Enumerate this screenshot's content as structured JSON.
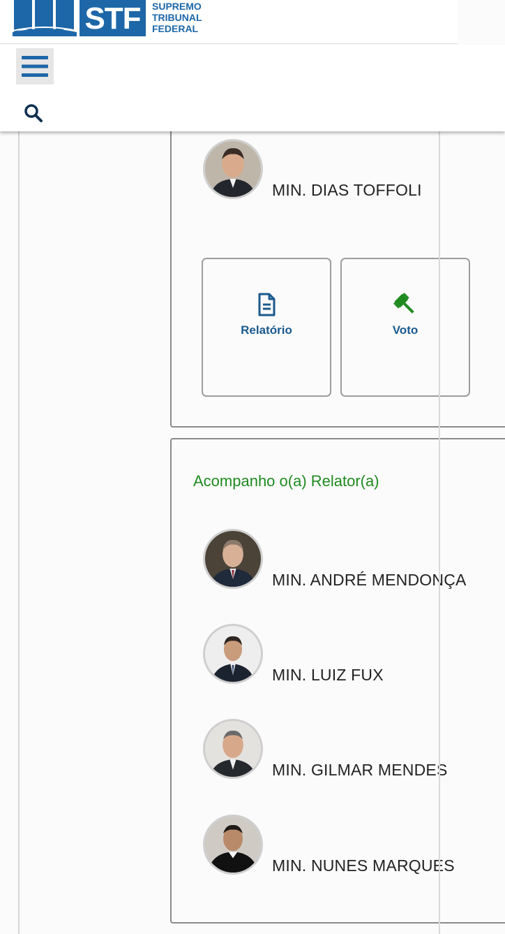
{
  "header": {
    "logo_abbr": "STF",
    "logo_line1": "SUPREMO",
    "logo_line2": "TRIBUNAL",
    "logo_line3": "FEDERAL",
    "brand_color": "#1d67a8"
  },
  "toolbar": {
    "menu_icon": "hamburger-icon",
    "search_icon": "search-icon"
  },
  "relator": {
    "name": "MIN. DIAS TOFFOLI",
    "actions": [
      {
        "label": "Relatório",
        "icon": "document-icon",
        "color": "#1b5a8e"
      },
      {
        "label": "Voto",
        "icon": "gavel-icon",
        "color": "#1f8a1f"
      }
    ]
  },
  "section": {
    "title": "Acompanho o(a) Relator(a)",
    "title_color": "#1f8a1f",
    "ministers": [
      {
        "name": "MIN. ANDRÉ MENDONÇA"
      },
      {
        "name": "MIN. LUIZ FUX"
      },
      {
        "name": "MIN. GILMAR MENDES"
      },
      {
        "name": "MIN. NUNES MARQUES"
      }
    ]
  }
}
